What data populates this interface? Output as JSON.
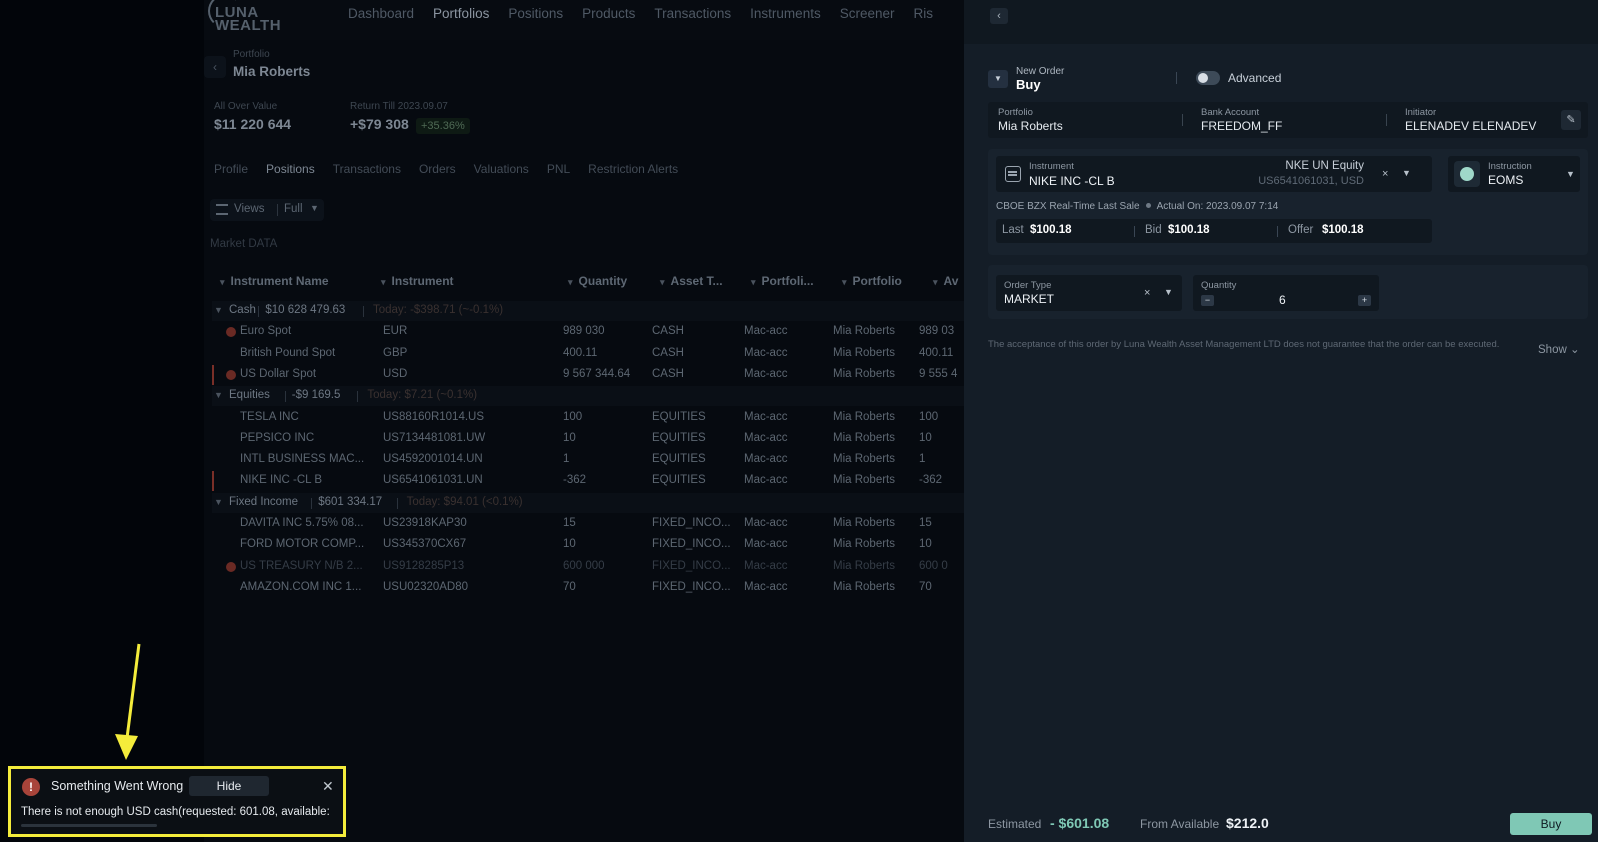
{
  "app": {
    "logo": "LUNA WEALTH",
    "nav": [
      "Dashboard",
      "Portfolios",
      "Positions",
      "Products",
      "Transactions",
      "Instruments",
      "Screener",
      "Ris"
    ],
    "portfolio_label": "Portfolio",
    "portfolio_name": "Mia Roberts",
    "summary": {
      "all_over_label": "All Over Value",
      "all_over_value": "$11 220 644",
      "return_label": "Return Till 2023.09.07",
      "return_value": "+$79 308",
      "return_pct": "+35.36%"
    },
    "subtabs": [
      "Profile",
      "Positions",
      "Transactions",
      "Orders",
      "Valuations",
      "PNL",
      "Restriction Alerts"
    ],
    "views": {
      "label": "Views",
      "value": "Full"
    },
    "market_data_label": "Market DATA",
    "columns": [
      "Instrument Name",
      "Instrument",
      "Quantity",
      "Asset T...",
      "Portfoli...",
      "Portfolio",
      "Av"
    ],
    "groups": [
      {
        "name": "Cash",
        "value": "$10 628 479.63",
        "today": "Today: -$398.71 (~-0.1%)",
        "rows": [
          {
            "name": "Euro Spot",
            "instrument": "EUR",
            "qty": "989 030",
            "asset": "CASH",
            "pf": "Mac-acc",
            "portfolio": "Mia Roberts",
            "av": "989 03",
            "warn": true
          },
          {
            "name": "British Pound Spot",
            "instrument": "GBP",
            "qty": "400.11",
            "asset": "CASH",
            "pf": "Mac-acc",
            "portfolio": "Mia Roberts",
            "av": "400.11"
          },
          {
            "name": "US Dollar Spot",
            "instrument": "USD",
            "qty": "9 567 344.64",
            "asset": "CASH",
            "pf": "Mac-acc",
            "portfolio": "Mia Roberts",
            "av": "9 555 4",
            "warn": true,
            "bar": true
          }
        ]
      },
      {
        "name": "Equities",
        "value": "-$9 169.5",
        "today": "Today: $7.21 (~0.1%)",
        "rows": [
          {
            "name": "TESLA INC",
            "instrument": "US88160R1014.US",
            "qty": "100",
            "asset": "EQUITIES",
            "pf": "Mac-acc",
            "portfolio": "Mia Roberts",
            "av": "100"
          },
          {
            "name": "PEPSICO INC",
            "instrument": "US7134481081.UW",
            "qty": "10",
            "asset": "EQUITIES",
            "pf": "Mac-acc",
            "portfolio": "Mia Roberts",
            "av": "10"
          },
          {
            "name": "INTL BUSINESS MAC...",
            "instrument": "US4592001014.UN",
            "qty": "1",
            "asset": "EQUITIES",
            "pf": "Mac-acc",
            "portfolio": "Mia Roberts",
            "av": "1"
          },
          {
            "name": "NIKE INC -CL B",
            "instrument": "US6541061031.UN",
            "qty": "-362",
            "asset": "EQUITIES",
            "pf": "Mac-acc",
            "portfolio": "Mia Roberts",
            "av": "-362",
            "bar": true
          }
        ]
      },
      {
        "name": "Fixed Income",
        "value": "$601 334.17",
        "today": "Today: $94.01 (<0.1%)",
        "rows": [
          {
            "name": "DAVITA INC 5.75% 08...",
            "instrument": "US23918KAP30",
            "qty": "15",
            "asset": "FIXED_INCO...",
            "pf": "Mac-acc",
            "portfolio": "Mia Roberts",
            "av": "15"
          },
          {
            "name": "FORD MOTOR COMP...",
            "instrument": "US345370CX67",
            "qty": "10",
            "asset": "FIXED_INCO...",
            "pf": "Mac-acc",
            "portfolio": "Mia Roberts",
            "av": "10"
          },
          {
            "name": "US TREASURY N/B 2...",
            "instrument": "US9128285P13",
            "qty": "600 000",
            "asset": "FIXED_INCO...",
            "pf": "Mac-acc",
            "portfolio": "Mia Roberts",
            "av": "600 0",
            "warn": true,
            "faded": true
          },
          {
            "name": "AMAZON.COM INC 1...",
            "instrument": "USU02320AD80",
            "qty": "70",
            "asset": "FIXED_INCO...",
            "pf": "Mac-acc",
            "portfolio": "Mia Roberts",
            "av": "70"
          }
        ]
      }
    ]
  },
  "panel": {
    "collapse_icon": "chevron-left-icon",
    "order_label": "New Order",
    "order_side": "Buy",
    "advanced_label": "Advanced",
    "advanced_on": false,
    "portfolio_label": "Portfolio",
    "portfolio_value": "Mia Roberts",
    "bank_label": "Bank Account",
    "bank_value": "FREEDOM_FF",
    "initiator_label": "Initiator",
    "initiator_value": "ELENADEV ELENADEV",
    "instrument_label": "Instrument",
    "instrument_value": "NIKE INC -CL B",
    "instrument_ticker": "NKE UN Equity",
    "instrument_isin": "US6541061031, USD",
    "instruction_label": "Instruction",
    "instruction_value": "EOMS",
    "quote_source": "CBOE BZX Real-Time Last Sale",
    "actual_on": "Actual On: 2023.09.07 7:14",
    "last_label": "Last",
    "last_value": "$100.18",
    "bid_label": "Bid",
    "bid_value": "$100.18",
    "offer_label": "Offer",
    "offer_value": "$100.18",
    "order_type_label": "Order Type",
    "order_type_value": "MARKET",
    "quantity_label": "Quantity",
    "quantity_value": "6",
    "disclaimer": "The acceptance of this order by Luna Wealth Asset Management LTD does not guarantee that the order can be executed.",
    "show_label": "Show",
    "estimated_label": "Estimated",
    "estimated_value": "- $601.08",
    "available_label": "From Available",
    "available_value": "$212.0",
    "buy_label": "Buy",
    "accent": "#7fc8b5"
  },
  "toast": {
    "title": "Something Went Wrong",
    "hide_label": "Hide",
    "message": "There is not enough USD cash(requested: 601.08, available:",
    "highlight_color": "#f4ec3b"
  }
}
